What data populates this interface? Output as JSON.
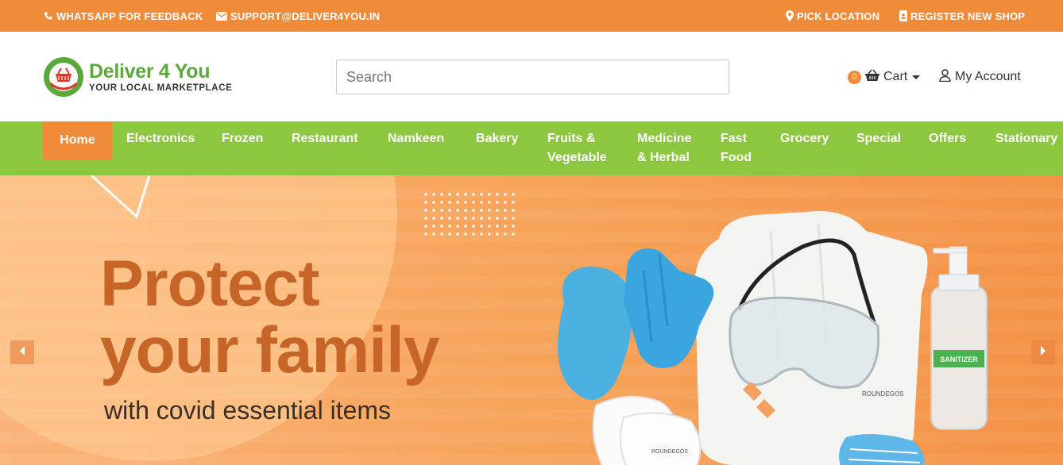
{
  "topbar": {
    "whatsapp": "WHATSAPP FOR FEEDBACK",
    "email": "SUPPORT@DELIVER4YOU.IN",
    "location": "PICK LOCATION",
    "register": "REGISTER NEW SHOP"
  },
  "header": {
    "logo_title": "Deliver 4 You",
    "logo_subtitle": "YOUR LOCAL MARKETPLACE",
    "search_placeholder": "Search",
    "cart_count": "0",
    "cart_label": "Cart",
    "account_label": "My Account"
  },
  "nav": {
    "items": [
      {
        "label": "Home"
      },
      {
        "label": "Electronics"
      },
      {
        "label": "Frozen"
      },
      {
        "label": "Restaurant"
      },
      {
        "label": "Namkeen"
      },
      {
        "label": "Bakery"
      },
      {
        "label": "Fruits &\nVegetable"
      },
      {
        "label": "Medicine\n& Herbal"
      },
      {
        "label": "Fast\nFood"
      },
      {
        "label": "Grocery"
      },
      {
        "label": "Special"
      },
      {
        "label": "Offers"
      },
      {
        "label": "Stationary"
      }
    ]
  },
  "hero": {
    "line1": "Protect",
    "line2": "your family",
    "line3": "with covid essential items",
    "product_label": "SANITIZER"
  },
  "colors": {
    "topbar": "#f08b3a",
    "nav": "#8dc63f",
    "active_nav": "#f08b3a",
    "brand_green": "#5ca93b",
    "hero_text": "#c76427"
  },
  "icons": {
    "whatsapp": "phone-icon",
    "email": "envelope-icon",
    "location": "map-marker-icon",
    "register": "id-badge-icon",
    "cart": "basket-icon",
    "account": "user-icon"
  }
}
